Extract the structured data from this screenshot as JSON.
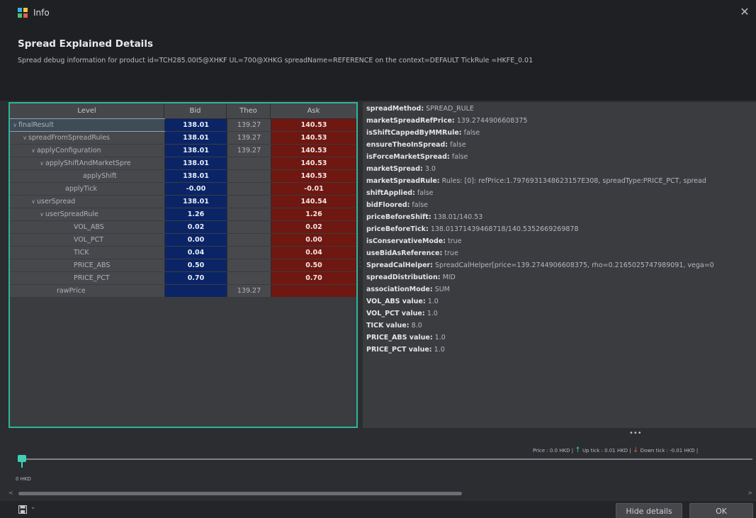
{
  "window": {
    "title": "Info"
  },
  "header": {
    "title": "Spread Explained Details",
    "description": "Spread debug information for product id=TCH285.00I5@XHKF UL=700@XHKG spreadName=REFERENCE on the context=DEFAULT TickRule =HKFE_0.01"
  },
  "tree": {
    "columns": {
      "level": "Level",
      "bid": "Bid",
      "theo": "Theo",
      "ask": "Ask"
    },
    "rows": [
      {
        "level": "finalResult",
        "bid": "138.01",
        "theo": "139.27",
        "ask": "140.53"
      },
      {
        "level": "spreadFromSpreadRules",
        "bid": "138.01",
        "theo": "139.27",
        "ask": "140.53"
      },
      {
        "level": "applyConfiguration",
        "bid": "138.01",
        "theo": "139.27",
        "ask": "140.53"
      },
      {
        "level": "applyShiftAndMarketSpre",
        "bid": "138.01",
        "theo": "",
        "ask": "140.53"
      },
      {
        "level": "applyShift",
        "bid": "138.01",
        "theo": "",
        "ask": "140.53"
      },
      {
        "level": "applyTick",
        "bid": "-0.00",
        "theo": "",
        "ask": "-0.01"
      },
      {
        "level": "userSpread",
        "bid": "138.01",
        "theo": "",
        "ask": "140.54"
      },
      {
        "level": "userSpreadRule",
        "bid": "1.26",
        "theo": "",
        "ask": "1.26"
      },
      {
        "level": "VOL_ABS",
        "bid": "0.02",
        "theo": "",
        "ask": "0.02"
      },
      {
        "level": "VOL_PCT",
        "bid": "0.00",
        "theo": "",
        "ask": "0.00"
      },
      {
        "level": "TICK",
        "bid": "0.04",
        "theo": "",
        "ask": "0.04"
      },
      {
        "level": "PRICE_ABS",
        "bid": "0.50",
        "theo": "",
        "ask": "0.50"
      },
      {
        "level": "PRICE_PCT",
        "bid": "0.70",
        "theo": "",
        "ask": "0.70"
      },
      {
        "level": "rawPrice",
        "bid": "",
        "theo": "139.27",
        "ask": ""
      }
    ]
  },
  "details": [
    {
      "key": "spreadMethod:",
      "value": "SPREAD_RULE"
    },
    {
      "key": "marketSpreadRefPrice:",
      "value": "139.2744906608375"
    },
    {
      "key": "isShiftCappedByMMRule:",
      "value": "false"
    },
    {
      "key": "ensureTheoInSpread:",
      "value": "false"
    },
    {
      "key": "isForceMarketSpread:",
      "value": "false"
    },
    {
      "key": "marketSpread:",
      "value": "3.0"
    },
    {
      "key": "marketSpreadRule:",
      "value": "Rules: [0]: refPrice:1.7976931348623157E308, spreadType:PRICE_PCT, spread"
    },
    {
      "key": "shiftApplied:",
      "value": "false"
    },
    {
      "key": "bidFloored:",
      "value": "false"
    },
    {
      "key": "priceBeforeShift:",
      "value": "138.01/140.53"
    },
    {
      "key": "priceBeforeTick:",
      "value": "138.01371439468718/140.5352669269878"
    },
    {
      "key": "isConservativeMode:",
      "value": "true"
    },
    {
      "key": "useBidAsReference:",
      "value": "true"
    },
    {
      "key": "SpreadCalHelper:",
      "value": "SpreadCalHelper[price=139.2744906608375, rho=0.2165025747989091, vega=0"
    },
    {
      "key": "spreadDistribution:",
      "value": "MID"
    },
    {
      "key": "associationMode:",
      "value": "SUM"
    },
    {
      "key": "VOL_ABS value:",
      "value": "1.0"
    },
    {
      "key": "VOL_PCT value:",
      "value": "1.0"
    },
    {
      "key": "TICK value:",
      "value": "8.0"
    },
    {
      "key": "PRICE_ABS value:",
      "value": "1.0"
    },
    {
      "key": "PRICE_PCT value:",
      "value": "1.0"
    }
  ],
  "legend": {
    "price": "Price : 0.0 HKD |",
    "up": "Up tick : 0.01 HKD |",
    "down": "Down tick : -0.01 HKD |"
  },
  "slider": {
    "label": "0 HKD"
  },
  "footer": {
    "hide_details": "Hide details",
    "ok": "OK"
  },
  "colors": {
    "accent": "#2db59b",
    "bid": "#0a2466",
    "ask": "#6f1711"
  }
}
